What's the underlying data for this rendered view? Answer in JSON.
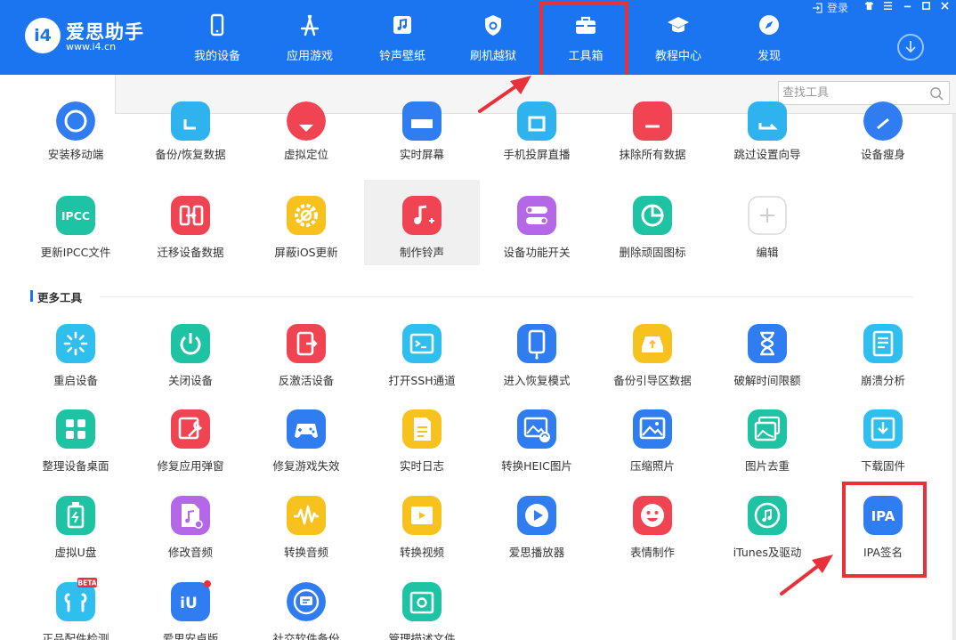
{
  "app": {
    "logo_badge": "i4",
    "name": "爱思助手",
    "url": "www.i4.cn"
  },
  "window_controls": {
    "login": "登录",
    "login_icon": "login-icon",
    "icons": [
      "shirt-icon",
      "menu-icon",
      "minimize-icon",
      "maximize-icon",
      "close-icon"
    ]
  },
  "nav": [
    {
      "label": "我的设备",
      "icon": "phone-icon"
    },
    {
      "label": "应用游戏",
      "icon": "appstore-icon"
    },
    {
      "label": "铃声壁纸",
      "icon": "music-note-icon"
    },
    {
      "label": "刷机越狱",
      "icon": "shield-icon"
    },
    {
      "label": "工具箱",
      "icon": "toolbox-icon",
      "active": true
    },
    {
      "label": "教程中心",
      "icon": "graduation-cap-icon"
    },
    {
      "label": "发现",
      "icon": "compass-icon"
    }
  ],
  "search": {
    "placeholder": "查找工具"
  },
  "tools_top_partial": [
    {
      "label": "安装移动端",
      "color": "#2f7df0"
    },
    {
      "label": "备份/恢复数据",
      "color": "#2fb3ee"
    },
    {
      "label": "虚拟定位",
      "color": "#f04452"
    },
    {
      "label": "实时屏幕",
      "color": "#2f7df0"
    },
    {
      "label": "手机投屏直播",
      "color": "#2fb3ee"
    },
    {
      "label": "抹除所有数据",
      "color": "#f04452"
    },
    {
      "label": "跳过设置向导",
      "color": "#2fb3ee"
    },
    {
      "label": "设备瘦身",
      "color": "#2f7df0"
    }
  ],
  "tools_row1": [
    {
      "label": "更新IPCC文件",
      "color": "#1ec3a3",
      "glyph": "IPCC"
    },
    {
      "label": "迁移设备数据",
      "color": "#f04452"
    },
    {
      "label": "屏蔽iOS更新",
      "color": "#f7c21d"
    },
    {
      "label": "制作铃声",
      "color": "#f04452"
    },
    {
      "label": "设备功能开关",
      "color": "#b467e6"
    },
    {
      "label": "删除顽固图标",
      "color": "#1ec3a3"
    },
    {
      "label": "编辑",
      "color": "#ffffff"
    }
  ],
  "section_more": {
    "title": "更多工具"
  },
  "tools_more": [
    {
      "label": "重启设备",
      "color": "#2fbfee"
    },
    {
      "label": "关闭设备",
      "color": "#1ec3a3"
    },
    {
      "label": "反激活设备",
      "color": "#f04452"
    },
    {
      "label": "打开SSH通道",
      "color": "#2fbfee"
    },
    {
      "label": "进入恢复模式",
      "color": "#2f7df0"
    },
    {
      "label": "备份引导区数据",
      "color": "#f7c21d"
    },
    {
      "label": "破解时间限额",
      "color": "#2f7df0"
    },
    {
      "label": "崩溃分析",
      "color": "#2fbfee"
    },
    {
      "label": "整理设备桌面",
      "color": "#1ec3a3"
    },
    {
      "label": "修复应用弹窗",
      "color": "#f04452"
    },
    {
      "label": "修复游戏失效",
      "color": "#2f7df0"
    },
    {
      "label": "实时日志",
      "color": "#f7c21d"
    },
    {
      "label": "转换HEIC图片",
      "color": "#2f7df0"
    },
    {
      "label": "压缩照片",
      "color": "#2f7df0"
    },
    {
      "label": "图片去重",
      "color": "#1ec3a3"
    },
    {
      "label": "下载固件",
      "color": "#2fbfee"
    },
    {
      "label": "虚拟U盘",
      "color": "#1ec3a3"
    },
    {
      "label": "修改音频",
      "color": "#b467e6"
    },
    {
      "label": "转换音频",
      "color": "#f7c21d"
    },
    {
      "label": "转换视频",
      "color": "#f7c21d"
    },
    {
      "label": "爱思播放器",
      "color": "#2f7df0"
    },
    {
      "label": "表情制作",
      "color": "#f04452"
    },
    {
      "label": "iTunes及驱动",
      "color": "#1ec3a3"
    },
    {
      "label": "IPA签名",
      "color": "#2f7df0",
      "glyph": "IPA"
    },
    {
      "label": "正品配件检测",
      "color": "#2fbfee",
      "badge": "BETA"
    },
    {
      "label": "爱思安卓版",
      "color": "#2f7df0"
    },
    {
      "label": "社交软件备份",
      "color": "#2f7df0"
    },
    {
      "label": "管理描述文件",
      "color": "#1ec3a3"
    }
  ]
}
